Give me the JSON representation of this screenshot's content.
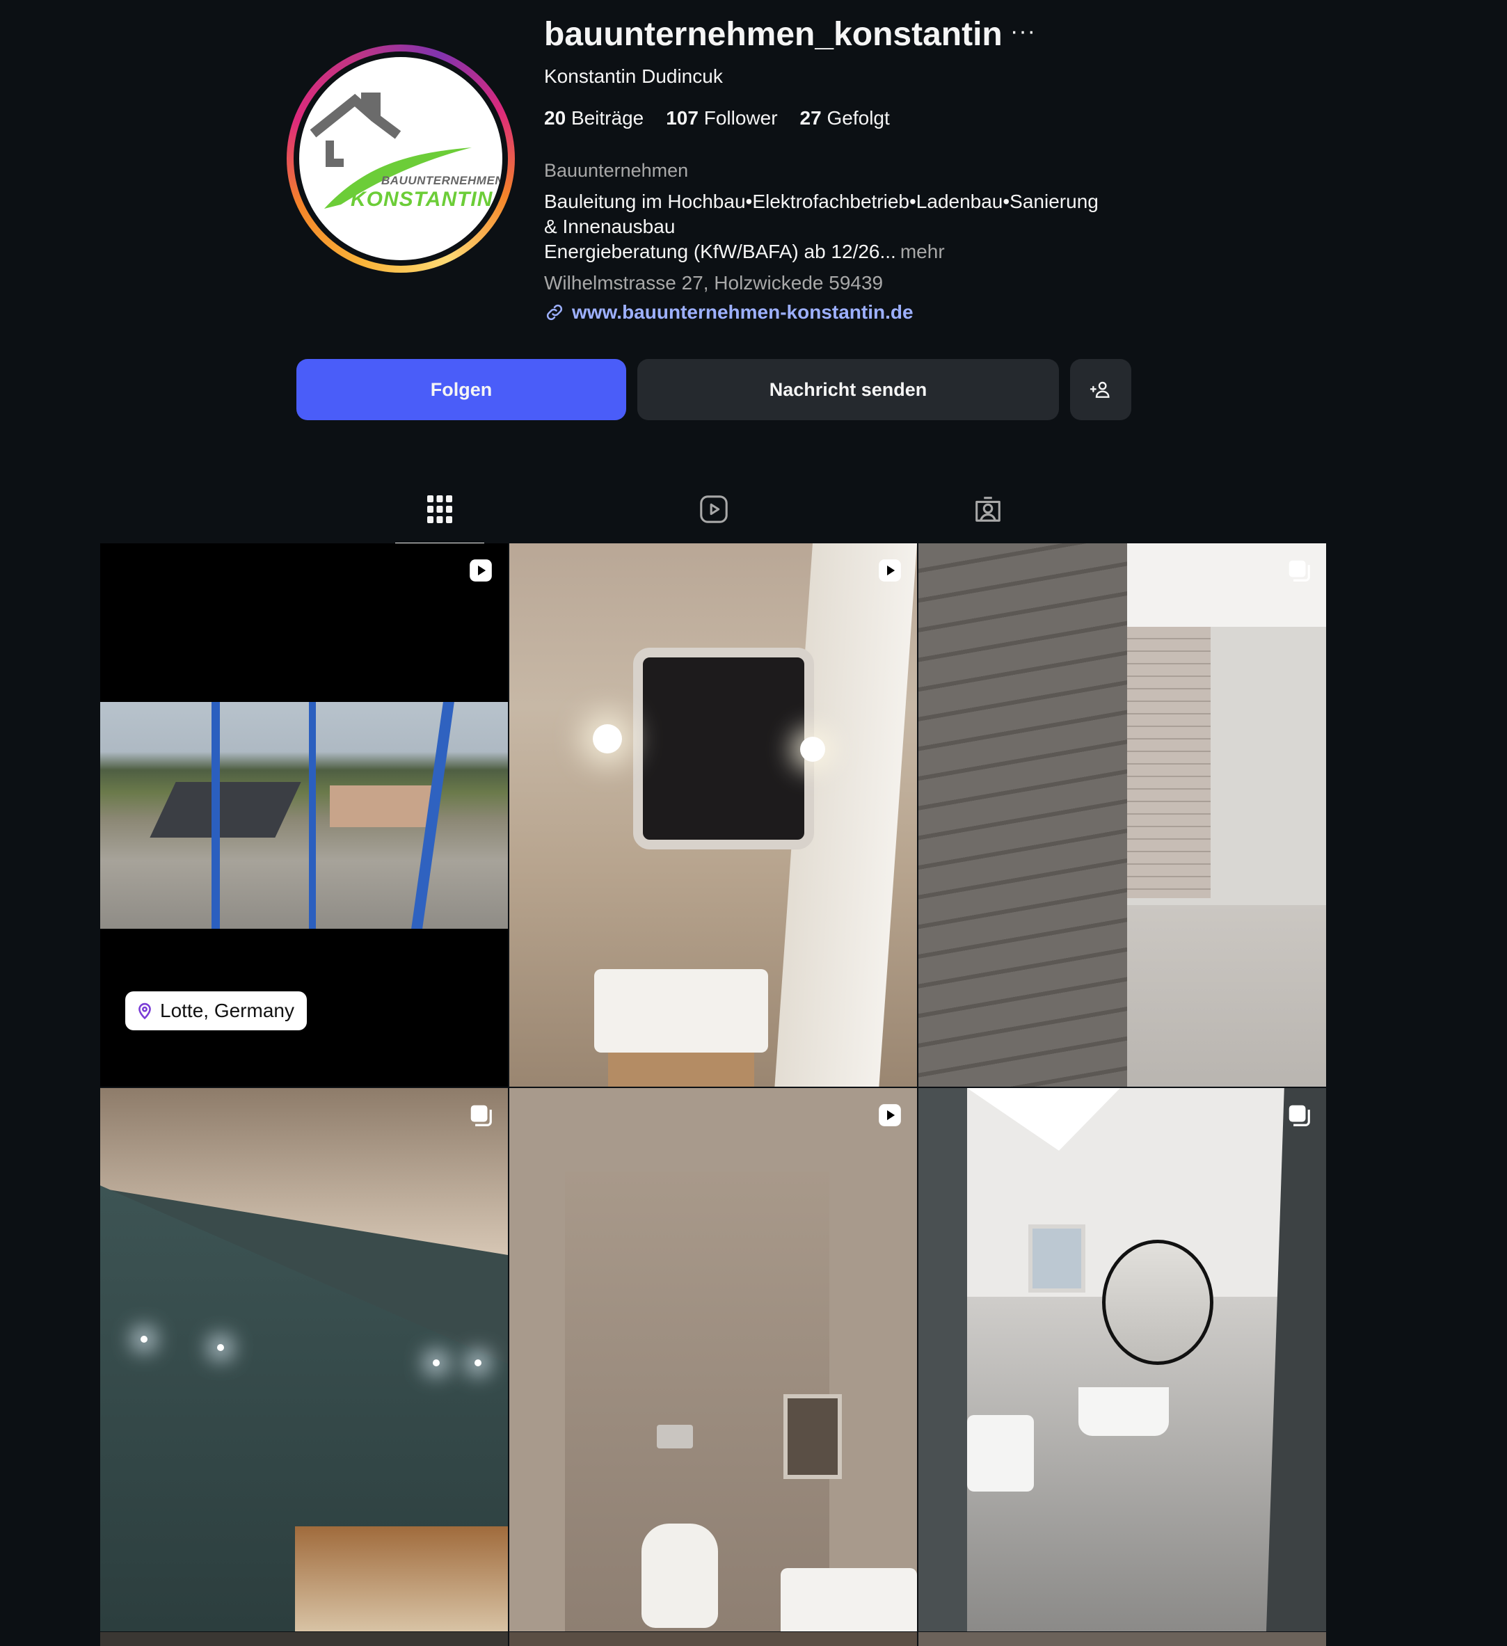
{
  "profile": {
    "username": "bauunternehmen_konstantin",
    "more_icon": "more-horizontal-icon",
    "full_name": "Konstantin Dudincuk",
    "stats": {
      "posts_count": "20",
      "posts_label": "Beiträge",
      "followers_count": "107",
      "followers_label": "Follower",
      "following_count": "27",
      "following_label": "Gefolgt"
    },
    "category": "Bauunternehmen",
    "bio_line1": "Bauleitung im Hochbau•Elektrofachbetrieb•Ladenbau•Sanierung",
    "bio_line2": "& Innenausbau",
    "bio_line3": "Energieberatung (KfW/BAFA) ab 12/26...",
    "bio_more": "mehr",
    "address": "Wilhelmstrasse 27, Holzwickede 59439",
    "website": "www.bauunternehmen-konstantin.de",
    "logo_line1": "BAUUNTERNEHMEN",
    "logo_line2": "KONSTANTIN"
  },
  "actions": {
    "follow": "Folgen",
    "message": "Nachricht senden",
    "suggest_icon": "add-person-icon"
  },
  "tabs": [
    {
      "icon": "grid-icon",
      "active": true
    },
    {
      "icon": "reels-icon",
      "active": false
    },
    {
      "icon": "tagged-icon",
      "active": false
    }
  ],
  "posts": [
    {
      "type": "reel",
      "location": "Lotte, Germany"
    },
    {
      "type": "reel"
    },
    {
      "type": "carousel"
    },
    {
      "type": "carousel"
    },
    {
      "type": "reel"
    },
    {
      "type": "carousel"
    }
  ],
  "colors": {
    "background": "#0c1014",
    "follow_button": "#4a5df9",
    "secondary_button": "#25292e",
    "link": "#9db0ff"
  }
}
